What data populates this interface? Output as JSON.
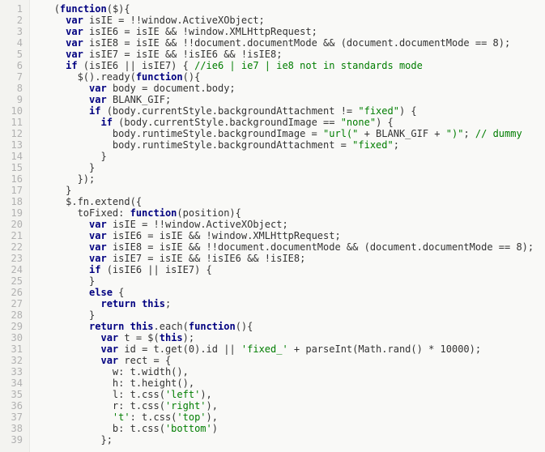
{
  "line_numbers": [
    "1",
    "2",
    "3",
    "4",
    "5",
    "6",
    "7",
    "8",
    "9",
    "10",
    "11",
    "12",
    "13",
    "14",
    "15",
    "16",
    "17",
    "18",
    "19",
    "20",
    "21",
    "22",
    "23",
    "24",
    "25",
    "26",
    "27",
    "28",
    "29",
    "30",
    "31",
    "32",
    "33",
    "34",
    "35",
    "36",
    "37",
    "38",
    "39"
  ],
  "code_lines": [
    {
      "i": "   ",
      "t": [
        [
          "pl",
          "("
        ],
        [
          "fn",
          "function"
        ],
        [
          "pl",
          "($){"
        ]
      ]
    },
    {
      "i": "     ",
      "t": [
        [
          "kw",
          "var"
        ],
        [
          "pl",
          " isIE = !!window.ActiveXObject;"
        ]
      ]
    },
    {
      "i": "     ",
      "t": [
        [
          "kw",
          "var"
        ],
        [
          "pl",
          " isIE6 = isIE && !window.XMLHttpRequest;"
        ]
      ]
    },
    {
      "i": "     ",
      "t": [
        [
          "kw",
          "var"
        ],
        [
          "pl",
          " isIE8 = isIE && !!document.documentMode && (document.documentMode == 8);"
        ]
      ]
    },
    {
      "i": "     ",
      "t": [
        [
          "kw",
          "var"
        ],
        [
          "pl",
          " isIE7 = isIE && !isIE6 && !isIE8;"
        ]
      ]
    },
    {
      "i": "     ",
      "t": [
        [
          "kw",
          "if"
        ],
        [
          "pl",
          " (isIE6 || isIE7) { "
        ],
        [
          "cmt",
          "//ie6 | ie7 | ie8 not in standards mode"
        ]
      ]
    },
    {
      "i": "       ",
      "t": [
        [
          "pl",
          "$().ready("
        ],
        [
          "fn",
          "function"
        ],
        [
          "pl",
          "(){"
        ]
      ]
    },
    {
      "i": "         ",
      "t": [
        [
          "kw",
          "var"
        ],
        [
          "pl",
          " body = document.body;"
        ]
      ]
    },
    {
      "i": "         ",
      "t": [
        [
          "kw",
          "var"
        ],
        [
          "pl",
          " BLANK_GIF;"
        ]
      ]
    },
    {
      "i": "         ",
      "t": [
        [
          "kw",
          "if"
        ],
        [
          "pl",
          " (body.currentStyle.backgroundAttachment != "
        ],
        [
          "str",
          "\"fixed\""
        ],
        [
          "pl",
          ") {"
        ]
      ]
    },
    {
      "i": "           ",
      "t": [
        [
          "kw",
          "if"
        ],
        [
          "pl",
          " (body.currentStyle.backgroundImage == "
        ],
        [
          "str",
          "\"none\""
        ],
        [
          "pl",
          ") {"
        ]
      ]
    },
    {
      "i": "             ",
      "t": [
        [
          "pl",
          "body.runtimeStyle.backgroundImage = "
        ],
        [
          "str",
          "\"url(\""
        ],
        [
          "pl",
          " + BLANK_GIF + "
        ],
        [
          "str",
          "\")\""
        ],
        [
          "pl",
          "; "
        ],
        [
          "cmt",
          "// dummy"
        ]
      ]
    },
    {
      "i": "             ",
      "t": [
        [
          "pl",
          "body.runtimeStyle.backgroundAttachment = "
        ],
        [
          "str",
          "\"fixed\""
        ],
        [
          "pl",
          ";"
        ]
      ]
    },
    {
      "i": "           ",
      "t": [
        [
          "pl",
          "}"
        ]
      ]
    },
    {
      "i": "         ",
      "t": [
        [
          "pl",
          "}"
        ]
      ]
    },
    {
      "i": "       ",
      "t": [
        [
          "pl",
          "});"
        ]
      ]
    },
    {
      "i": "     ",
      "t": [
        [
          "pl",
          "}"
        ]
      ]
    },
    {
      "i": "     ",
      "t": [
        [
          "pl",
          "$.fn.extend({"
        ]
      ]
    },
    {
      "i": "       ",
      "t": [
        [
          "pl",
          "toFixed: "
        ],
        [
          "fn",
          "function"
        ],
        [
          "pl",
          "(position){"
        ]
      ]
    },
    {
      "i": "         ",
      "t": [
        [
          "kw",
          "var"
        ],
        [
          "pl",
          " isIE = !!window.ActiveXObject;"
        ]
      ]
    },
    {
      "i": "         ",
      "t": [
        [
          "kw",
          "var"
        ],
        [
          "pl",
          " isIE6 = isIE && !window.XMLHttpRequest;"
        ]
      ]
    },
    {
      "i": "         ",
      "t": [
        [
          "kw",
          "var"
        ],
        [
          "pl",
          " isIE8 = isIE && !!document.documentMode && (document.documentMode == 8);"
        ]
      ]
    },
    {
      "i": "         ",
      "t": [
        [
          "kw",
          "var"
        ],
        [
          "pl",
          " isIE7 = isIE && !isIE6 && !isIE8;"
        ]
      ]
    },
    {
      "i": "         ",
      "t": [
        [
          "kw",
          "if"
        ],
        [
          "pl",
          " (isIE6 || isIE7) {"
        ]
      ]
    },
    {
      "i": "         ",
      "t": [
        [
          "pl",
          "}"
        ]
      ]
    },
    {
      "i": "         ",
      "t": [
        [
          "el",
          "else"
        ],
        [
          "pl",
          " {"
        ]
      ]
    },
    {
      "i": "           ",
      "t": [
        [
          "ret",
          "return"
        ],
        [
          "pl",
          " "
        ],
        [
          "th",
          "this"
        ],
        [
          "pl",
          ";"
        ]
      ]
    },
    {
      "i": "         ",
      "t": [
        [
          "pl",
          "}"
        ]
      ]
    },
    {
      "i": "         ",
      "t": [
        [
          "ret",
          "return"
        ],
        [
          "pl",
          " "
        ],
        [
          "th",
          "this"
        ],
        [
          "pl",
          ".each("
        ],
        [
          "fn",
          "function"
        ],
        [
          "pl",
          "(){"
        ]
      ]
    },
    {
      "i": "           ",
      "t": [
        [
          "kw",
          "var"
        ],
        [
          "pl",
          " t = $("
        ],
        [
          "th",
          "this"
        ],
        [
          "pl",
          ");"
        ]
      ]
    },
    {
      "i": "           ",
      "t": [
        [
          "kw",
          "var"
        ],
        [
          "pl",
          " id = t.get(0).id || "
        ],
        [
          "str",
          "'fixed_'"
        ],
        [
          "pl",
          " + parseInt(Math.rand() * 10000);"
        ]
      ]
    },
    {
      "i": "           ",
      "t": [
        [
          "kw",
          "var"
        ],
        [
          "pl",
          " rect = {"
        ]
      ]
    },
    {
      "i": "             ",
      "t": [
        [
          "pl",
          "w: t.width(),"
        ]
      ]
    },
    {
      "i": "             ",
      "t": [
        [
          "pl",
          "h: t.height(),"
        ]
      ]
    },
    {
      "i": "             ",
      "t": [
        [
          "pl",
          "l: t.css("
        ],
        [
          "str",
          "'left'"
        ],
        [
          "pl",
          "),"
        ]
      ]
    },
    {
      "i": "             ",
      "t": [
        [
          "pl",
          "r: t.css("
        ],
        [
          "str",
          "'right'"
        ],
        [
          "pl",
          "),"
        ]
      ]
    },
    {
      "i": "             ",
      "t": [
        [
          "str",
          "'t'"
        ],
        [
          "pl",
          ": t.css("
        ],
        [
          "str",
          "'top'"
        ],
        [
          "pl",
          "),"
        ]
      ]
    },
    {
      "i": "             ",
      "t": [
        [
          "pl",
          "b: t.css("
        ],
        [
          "str",
          "'bottom'"
        ],
        [
          "pl",
          ")"
        ]
      ]
    },
    {
      "i": "           ",
      "t": [
        [
          "pl",
          "};"
        ]
      ]
    }
  ]
}
